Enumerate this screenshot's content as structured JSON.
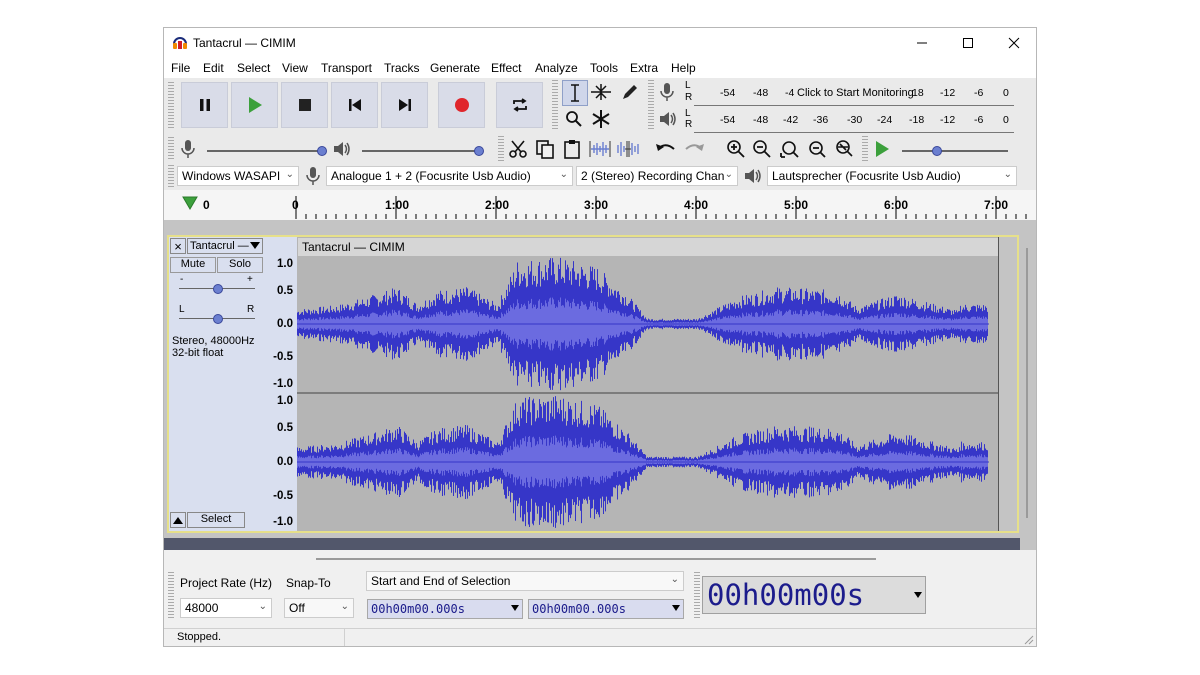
{
  "window": {
    "title": "Tantacrul — CIMIM"
  },
  "menu": [
    "File",
    "Edit",
    "Select",
    "View",
    "Transport",
    "Tracks",
    "Generate",
    "Effect",
    "Analyze",
    "Tools",
    "Extra",
    "Help"
  ],
  "meters": {
    "record_scale": [
      "-54",
      "-48",
      "-4",
      "18",
      "-12",
      "-6",
      "0"
    ],
    "record_prompt": "Click to Start Monitoring",
    "play_scale": [
      "-54",
      "-48",
      "-42",
      "-36",
      "-30",
      "-24",
      "-18",
      "-12",
      "-6",
      "0"
    ],
    "channel_left": "L",
    "channel_right": "R"
  },
  "devices": {
    "host": "Windows WASAPI",
    "recording_device": "Analogue 1 + 2 (Focusrite Usb Audio)",
    "channels": "2 (Stereo) Recording Chann",
    "playback_device": "Lautsprecher (Focusrite Usb Audio)"
  },
  "ruler": {
    "labels": [
      "0",
      "0",
      "1:00",
      "2:00",
      "3:00",
      "4:00",
      "5:00",
      "6:00",
      "7:00"
    ]
  },
  "track": {
    "name": "Tantacrul —",
    "mute_label": "Mute",
    "solo_label": "Solo",
    "gain_minus": "-",
    "gain_plus": "+",
    "pan_left": "L",
    "pan_right": "R",
    "info_rate": "Stereo, 48000Hz",
    "info_format": "32-bit float",
    "select_label": "Select",
    "clip_title": "Tantacrul — CIMIM",
    "scale_labels": [
      "1.0",
      "0.5",
      "0.0",
      "-0.5",
      "-1.0"
    ],
    "close_label": "×"
  },
  "bottom": {
    "project_rate_label": "Project Rate (Hz)",
    "project_rate_value": "48000",
    "snap_to_label": "Snap-To",
    "snap_to_value": "Off",
    "selection_mode": "Start and End of Selection",
    "selection_start": "00h00m00.000s",
    "selection_end": "00h00m00.000s",
    "audio_position": "00h00m00s"
  },
  "status": {
    "text": "Stopped."
  },
  "colors": {
    "waveform": "#3636c8",
    "waveform_rms": "#6b6be0",
    "accent_selected_border": "#e6e08a",
    "record": "#e0262c",
    "play": "#3ca03c"
  }
}
